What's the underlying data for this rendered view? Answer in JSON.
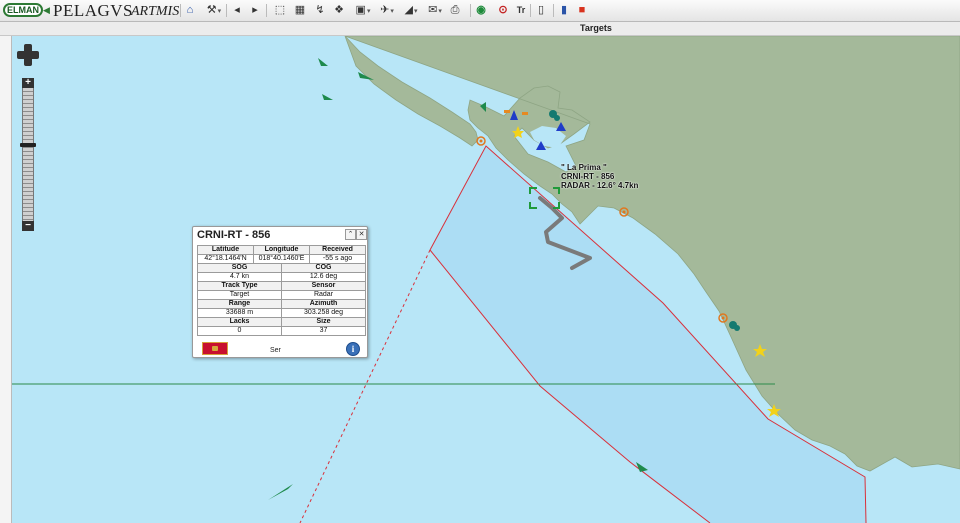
{
  "app": {
    "logo_text": "ELMAN",
    "product_name": "PELAGVS",
    "product_suffix": "ARTMIS"
  },
  "toolbar": {
    "buttons": [
      {
        "name": "home-button",
        "icon": "home-icon",
        "glyph": "⌂",
        "dropdown": false
      },
      {
        "name": "tools-dropdown-button",
        "icon": "wrench-icon",
        "glyph": "⚒",
        "dropdown": true
      },
      {
        "name": "back-button",
        "icon": "chevron-left-icon",
        "glyph": "◂",
        "dropdown": false
      },
      {
        "name": "forward-button",
        "icon": "chevron-right-icon",
        "glyph": "▸",
        "dropdown": false
      },
      {
        "name": "select-button",
        "icon": "cursor-icon",
        "glyph": "⬚",
        "dropdown": false
      },
      {
        "name": "chart-button",
        "icon": "chart-icon",
        "glyph": "▦",
        "dropdown": false
      },
      {
        "name": "route-button",
        "icon": "route-icon",
        "glyph": "↯",
        "dropdown": false
      },
      {
        "name": "layers-button",
        "icon": "layers-icon",
        "glyph": "❖",
        "dropdown": false
      },
      {
        "name": "overlay-dropdown-button",
        "icon": "overlay-icon",
        "glyph": "▣",
        "dropdown": true
      },
      {
        "name": "aircraft-dropdown-button",
        "icon": "airplane-icon",
        "glyph": "✈",
        "dropdown": true
      },
      {
        "name": "area-dropdown-button",
        "icon": "area-icon",
        "glyph": "◢",
        "dropdown": true
      },
      {
        "name": "mail-dropdown-button",
        "icon": "mail-icon",
        "glyph": "✉",
        "dropdown": true
      },
      {
        "name": "print-button",
        "icon": "printer-icon",
        "glyph": "⎙",
        "dropdown": false
      },
      {
        "name": "record-button",
        "icon": "record-icon",
        "glyph": "◉",
        "dropdown": false
      },
      {
        "name": "stop-button",
        "icon": "target-icon",
        "glyph": "⊙",
        "dropdown": false
      },
      {
        "name": "text-button",
        "icon": "text-icon",
        "glyph": "Tr",
        "dropdown": false
      },
      {
        "name": "page-button",
        "icon": "page-icon",
        "glyph": "▯",
        "dropdown": false
      },
      {
        "name": "book-button",
        "icon": "book-icon",
        "glyph": "▮",
        "dropdown": false
      },
      {
        "name": "alert-button",
        "icon": "alert-icon",
        "glyph": "■",
        "dropdown": false
      }
    ]
  },
  "targets_panel": {
    "title": "Targets"
  },
  "popup": {
    "title": "CRNI-RT - 856",
    "close_glyph": "✕",
    "collapse_glyph": "⌃",
    "headers_row1": [
      "Latitude",
      "Longitude",
      "Received"
    ],
    "values_row1": [
      "42°18.1464'N",
      "018°40.1460'E",
      "-55 s ago"
    ],
    "rows": [
      {
        "left_label": "SOG",
        "left_value": "4.7 kn",
        "right_label": "COG",
        "right_value": "12.6 deg"
      },
      {
        "left_label": "Track Type",
        "left_value": "Target",
        "right_label": "Sensor",
        "right_value": "Radar"
      },
      {
        "left_label": "Range",
        "left_value": "33688 m",
        "right_label": "Azimuth",
        "right_value": "303.258 deg"
      },
      {
        "left_label": "Lacks",
        "left_value": "0",
        "right_label": "Size",
        "right_value": "37"
      }
    ],
    "flag_color": "#c8102e",
    "footer_text": "Ser",
    "info_glyph": "i"
  },
  "vessel_label": {
    "line1": "\" La Prima \"",
    "line2": "CRNI-RT - 856",
    "line3": "RADAR - 12.6° 4.7kn"
  },
  "map": {
    "sea_color": "#b8e6f7",
    "land_color": "#a4b99a",
    "coverage_color": "#d9303a",
    "track_color": "#7a7a7a",
    "selection_color": "#1f9a3a"
  }
}
